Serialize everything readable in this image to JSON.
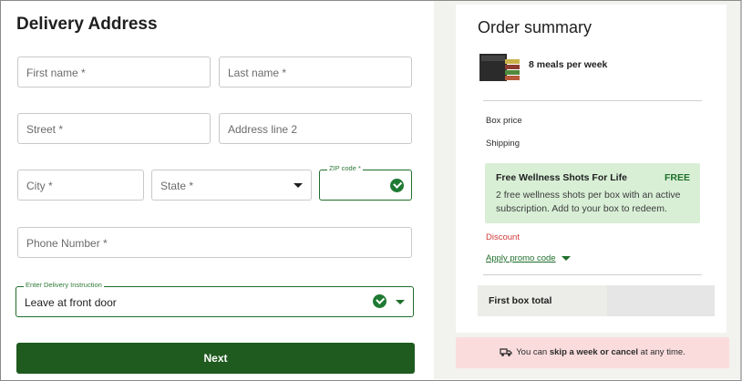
{
  "form": {
    "title": "Delivery Address",
    "first_name_placeholder": "First name *",
    "last_name_placeholder": "Last name *",
    "street_placeholder": "Street *",
    "address2_placeholder": "Address line 2",
    "city_placeholder": "City *",
    "state_placeholder": "State *",
    "zip_label": "ZIP code *",
    "zip_value": "",
    "phone_placeholder": "Phone Number *",
    "delivery_instruction_label": "Enter Delivery Instruction",
    "delivery_instruction_value": "Leave at front door",
    "next_label": "Next"
  },
  "summary": {
    "title": "Order summary",
    "meal_plan": "8 meals per week",
    "box_price_label": "Box price",
    "shipping_label": "Shipping",
    "promo": {
      "title": "Free Wellness Shots For Life",
      "badge": "FREE",
      "description": "2 free wellness shots per box with an active subscription. Add to your box to redeem."
    },
    "discount_label": "Discount",
    "apply_promo_label": "Apply promo code",
    "first_box_total_label": "First box total",
    "skip_text_prefix": "You can ",
    "skip_text_bold": "skip a week or cancel",
    "skip_text_suffix": " at any time."
  },
  "colors": {
    "brand_green": "#1f5a1f",
    "success_green": "#1f7a34",
    "promo_bg": "#d8efd6",
    "discount_red": "#d23b3b",
    "banner_pink": "#fbdcdc"
  }
}
